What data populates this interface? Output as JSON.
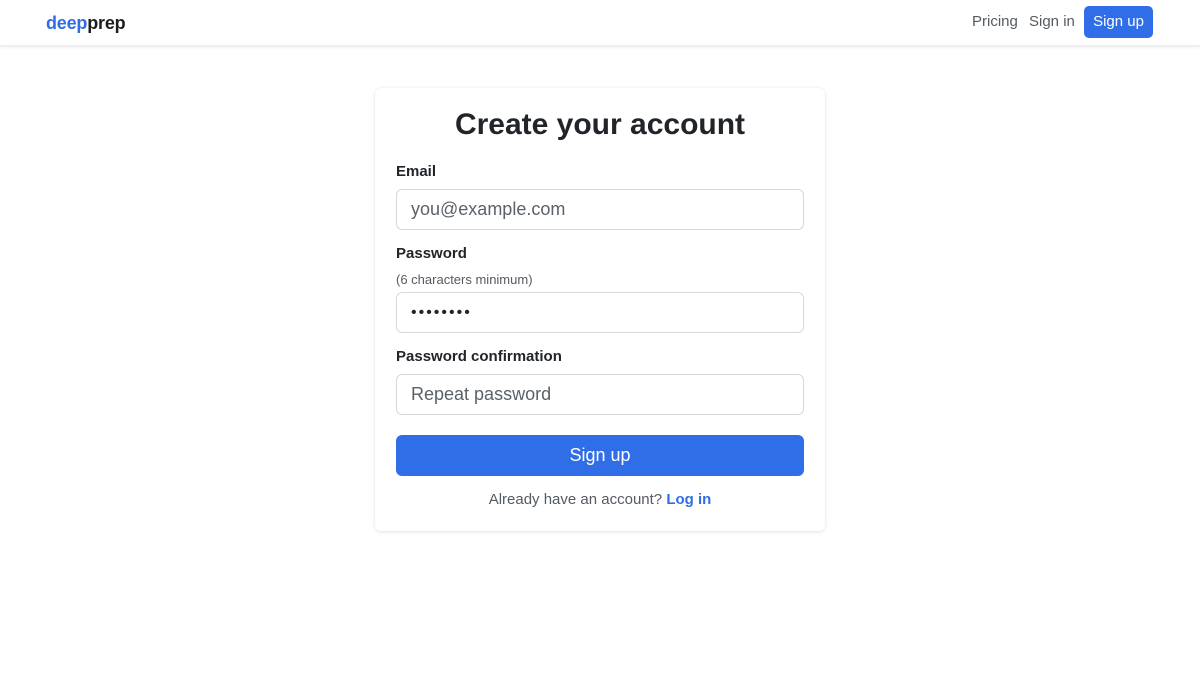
{
  "navbar": {
    "brand_part1": "deep",
    "brand_part2": "prep",
    "links": {
      "pricing": "Pricing",
      "sign_in": "Sign in"
    },
    "sign_up_button": "Sign up"
  },
  "form": {
    "title": "Create your account",
    "email": {
      "label": "Email",
      "placeholder": "you@example.com",
      "value": ""
    },
    "password": {
      "label": "Password",
      "hint": "(6 characters minimum)",
      "value": "••••••••"
    },
    "password_confirmation": {
      "label": "Password confirmation",
      "placeholder": "Repeat password",
      "value": ""
    },
    "submit_label": "Sign up",
    "footer_prefix": "Already have an account?",
    "login_link": "Log in"
  },
  "colors": {
    "accent": "#2f6ee6",
    "text": "#212529",
    "muted": "#555b62"
  }
}
